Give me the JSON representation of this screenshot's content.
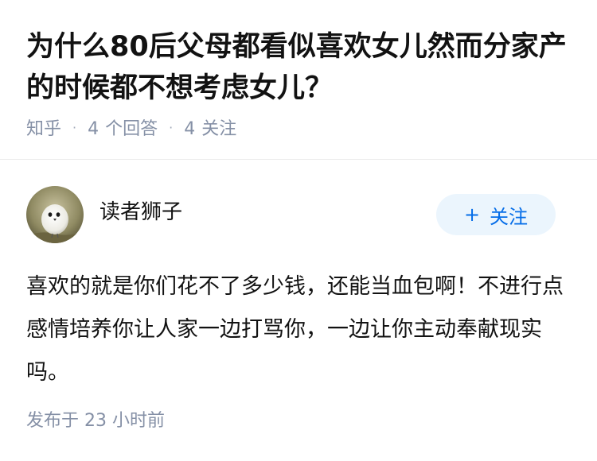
{
  "question": {
    "title": "为什么80后父母都看似喜欢女儿然而分家产的时候都不想考虑女儿？",
    "source": "知乎",
    "answer_count": "4",
    "answer_label": "个回答",
    "follower_count": "4",
    "follower_label": "关注"
  },
  "answer": {
    "author": {
      "name": "读者狮子",
      "avatar_icon": "bird-avatar-icon"
    },
    "follow_button": {
      "icon": "+",
      "label": "关注"
    },
    "content": "喜欢的就是你们花不了多少钱，还能当血包啊！不进行点感情培养你让人家一边打骂你，一边让你主动奉献现实吗。",
    "published": "发布于 23 小时前"
  },
  "colors": {
    "accent": "#056de8",
    "accent_bg": "#ebf5fd",
    "meta_gray": "#8590a6",
    "text": "#121212"
  }
}
